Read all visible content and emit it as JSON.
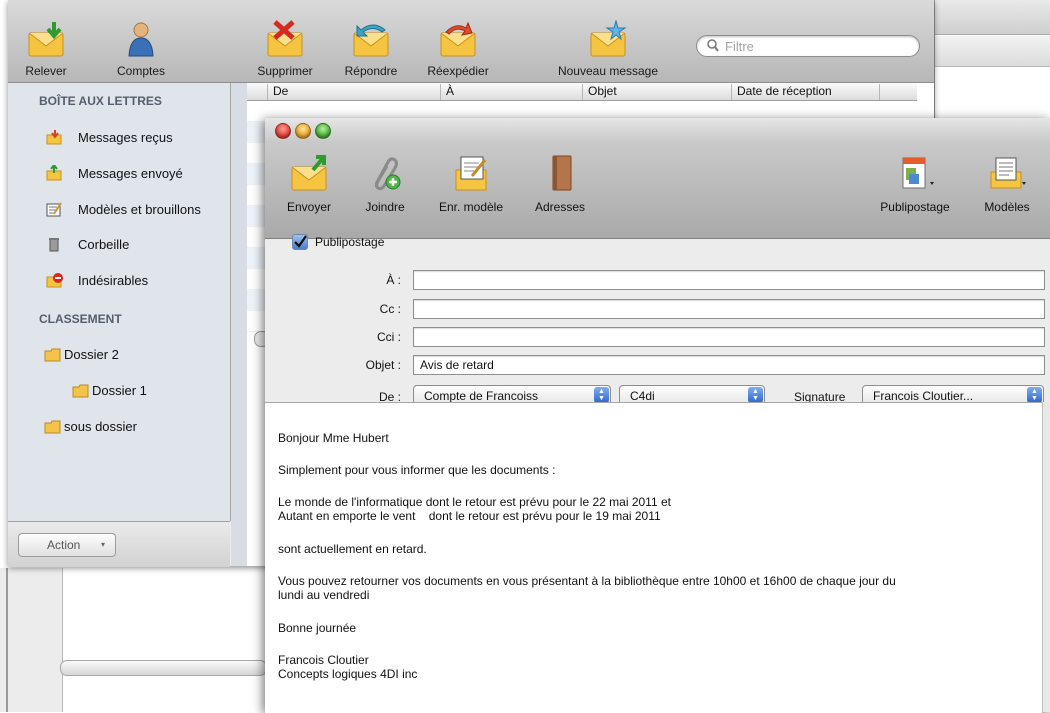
{
  "mail_window": {
    "toolbar": {
      "get_mail": "Relever",
      "accounts": "Comptes",
      "delete": "Supprimer",
      "reply": "Répondre",
      "forward": "Réexpédier",
      "new_message": "Nouveau message"
    },
    "search": {
      "placeholder": "Filtre"
    },
    "sidebar": {
      "mailbox_header": "BOÎTE AUX LETTRES",
      "items": [
        {
          "label": "Messages reçus",
          "icon": "inbox-icon"
        },
        {
          "label": "Messages envoyé",
          "icon": "sent-icon"
        },
        {
          "label": "Modèles et brouillons",
          "icon": "drafts-icon"
        },
        {
          "label": "Corbeille",
          "icon": "trash-icon"
        },
        {
          "label": "Indésirables",
          "icon": "junk-icon"
        }
      ],
      "folders_header": "CLASSEMENT",
      "folders": [
        {
          "label": "Dossier 2"
        },
        {
          "label": "Dossier 1"
        },
        {
          "label": "sous dossier"
        }
      ],
      "action_button": "Action"
    },
    "list_columns": [
      "De",
      "À",
      "Objet",
      "Date de réception"
    ]
  },
  "compose_window": {
    "toolbar": {
      "send": "Envoyer",
      "attach": "Joindre",
      "save_template": "Enr. modèle",
      "addresses": "Adresses",
      "mail_merge": "Publipostage",
      "templates": "Modèles"
    },
    "mail_merge_checkbox": {
      "label": "Publipostage",
      "checked": true
    },
    "fields": {
      "to_label": "À :",
      "to_value": "",
      "cc_label": "Cc :",
      "cc_value": "",
      "bcc_label": "Cci :",
      "bcc_value": "",
      "subject_label": "Objet :",
      "subject_value": "Avis de retard",
      "from_label": "De :",
      "from_account": "Compte de Francoiss",
      "from_identity": "C4di",
      "signature_label": "Signature",
      "signature_value": "Francois Cloutier..."
    },
    "body_lines": [
      "Bonjour Mme Hubert",
      "Simplement pour vous informer que les documents :",
      "Le monde de l'informatique dont le retour est prévu pour le 22 mai 2011 et",
      "Autant en emporte le vent    dont le retour est prévu pour le 19 mai 2011",
      "sont actuellement en retard.",
      "Vous pouvez retourner vos documents en vous présentant à la bibliothèque entre 10h00 et 16h00 de chaque jour du",
      "lundi au vendredi",
      "Bonne journée",
      "Francois Cloutier",
      "Concepts logiques 4DI inc"
    ]
  },
  "colors": {
    "accent_blue": "#3c78d8",
    "sidebar_bg": "#e0e5ec",
    "traffic_red": "#e2453c",
    "traffic_yellow": "#e9a92b",
    "traffic_green": "#4fb43b"
  }
}
